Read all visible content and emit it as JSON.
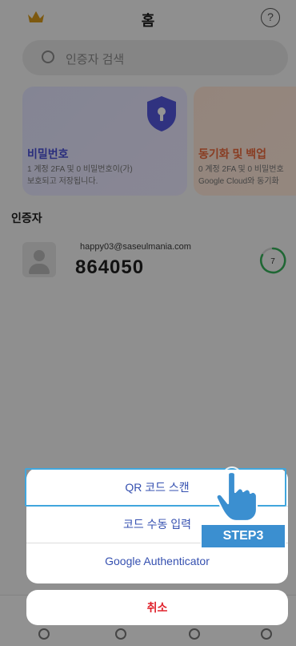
{
  "header": {
    "title": "홈",
    "help_glyph": "?",
    "crown_icon": "crown-icon"
  },
  "search": {
    "placeholder": "인증자 검색"
  },
  "cards": [
    {
      "title": "비밀번호",
      "desc_line1": "1 계정 2FA 및 0 비밀번호이(가)",
      "desc_line2": "보호되고 저장됩니다.",
      "accent": "#4950d8"
    },
    {
      "title": "동기화 및 백업",
      "desc_line1": "0 계정 2FA 및 0 비밀번호",
      "desc_line2": "Google Cloud와 동기화",
      "accent": "#ec6a3d"
    }
  ],
  "authenticators_section": {
    "title": "인증자"
  },
  "authenticator": {
    "email": "happy03@saseulmania.com",
    "code": "864050",
    "timer_seconds": "7",
    "timer_color": "#36b25a"
  },
  "action_sheet": {
    "items": [
      {
        "label": "QR 코드 스캔"
      },
      {
        "label": "코드 수동 입력"
      },
      {
        "label": "Google Authenticator"
      }
    ],
    "cancel_label": "취소"
  },
  "tutorial": {
    "step_label": "STEP3",
    "highlight_color": "#41a6dd",
    "badge_color": "#3b8fd0"
  }
}
